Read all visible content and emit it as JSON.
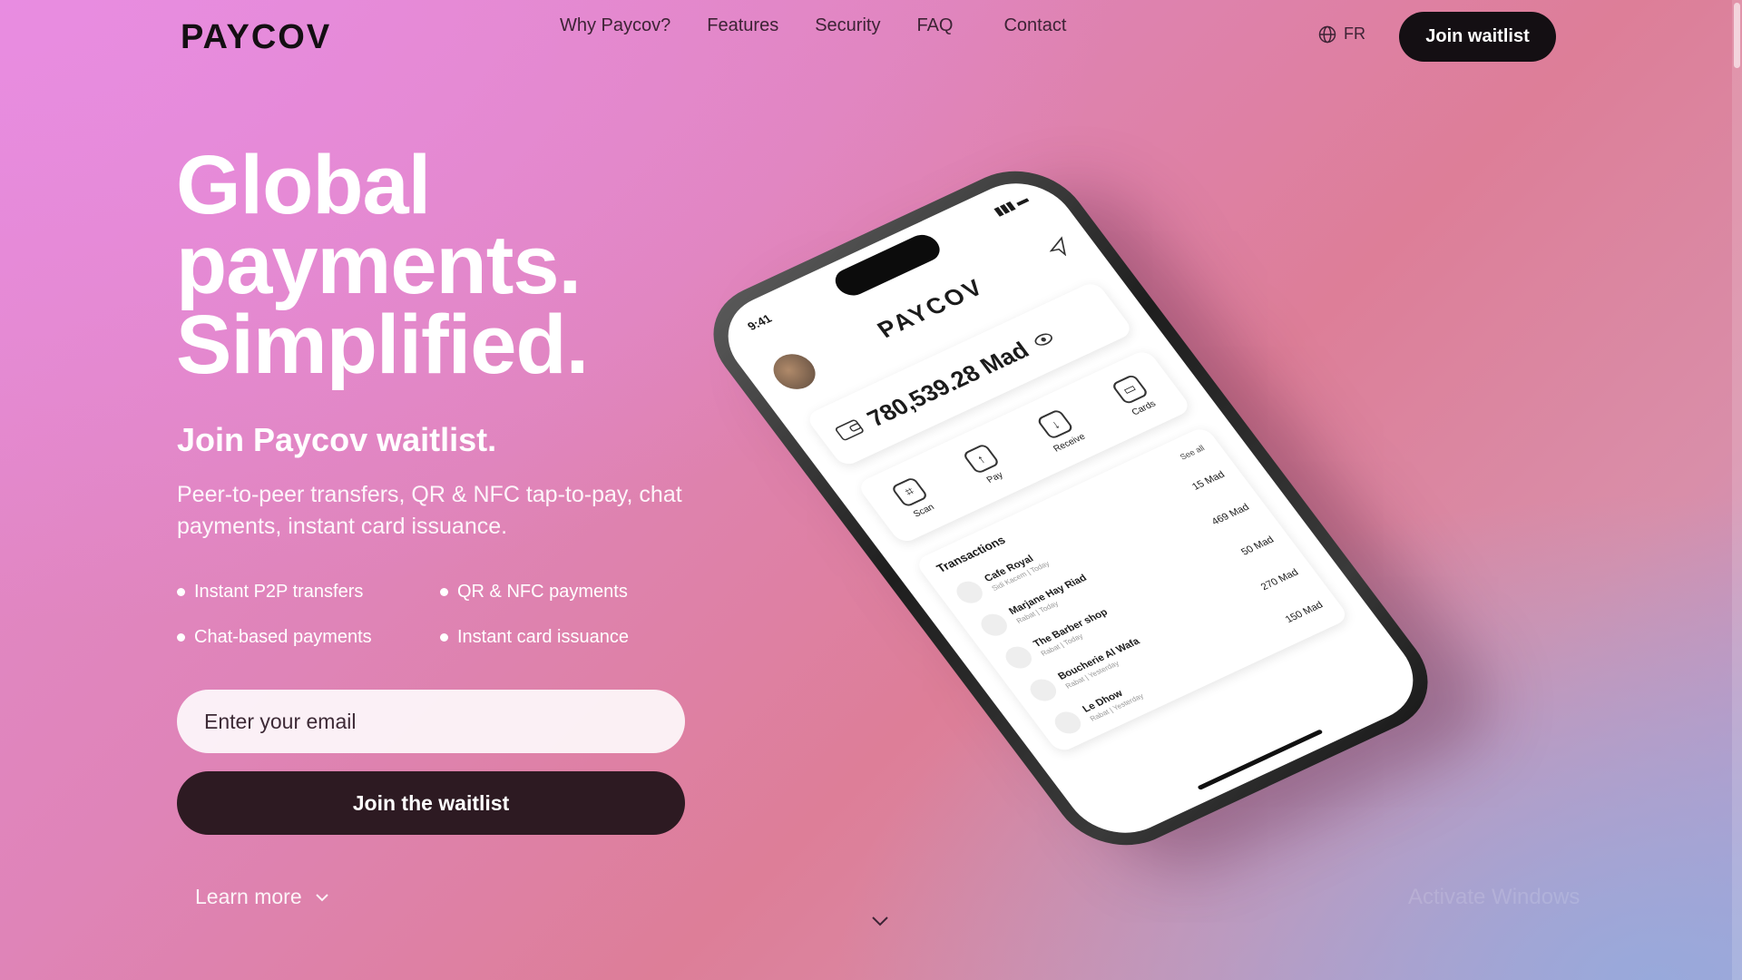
{
  "brand": {
    "logo": "PAYCOV"
  },
  "nav": {
    "items": [
      "Why Paycov?",
      "Features",
      "Security",
      "FAQ",
      "Contact"
    ]
  },
  "header": {
    "lang": "FR",
    "cta": "Join waitlist"
  },
  "hero": {
    "title_lines": [
      "Global",
      "payments.",
      "Simplified."
    ],
    "subtitle": "Join Paycov waitlist.",
    "description": "Peer-to-peer transfers, QR & NFC tap-to-pay, chat payments, instant card issuance.",
    "features": [
      "Instant P2P transfers",
      "QR & NFC payments",
      "Chat-based payments",
      "Instant card issuance"
    ],
    "email_placeholder": "Enter your email",
    "join_button": "Join the waitlist",
    "learn_more": "Learn more"
  },
  "phone": {
    "time": "9:41",
    "app_logo": "PAYCOV",
    "balance": "780,539.28 Mad",
    "actions": [
      "Scan",
      "Pay",
      "Receive",
      "Cards"
    ],
    "transactions_title": "Transactions",
    "see_all": "See all",
    "transactions": [
      {
        "name": "Cafe Royal",
        "meta": "Sidi Kacem | Today",
        "amount": "15 Mad"
      },
      {
        "name": "Marjane Hay Riad",
        "meta": "Rabat | Today",
        "amount": "469 Mad"
      },
      {
        "name": "The Barber shop",
        "meta": "Rabat | Today",
        "amount": "50 Mad"
      },
      {
        "name": "Boucherie Al Wafa",
        "meta": "Rabat | Yesterday",
        "amount": "270 Mad"
      },
      {
        "name": "Le Dhow",
        "meta": "Rabat | Yesterday",
        "amount": "150 Mad"
      }
    ]
  },
  "overlay": {
    "watermark": "Activate Windows"
  },
  "colors": {
    "cta_dark": "#140f13",
    "join_button": "#2d1a22",
    "text_dark": "#3d2335"
  }
}
